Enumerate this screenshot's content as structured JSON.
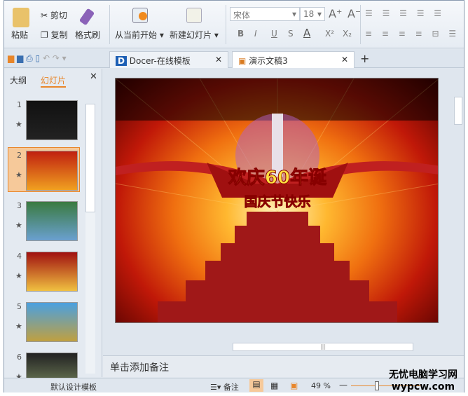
{
  "ribbon": {
    "paste": "粘贴",
    "cut": "剪切",
    "copy": "复制",
    "format_painter": "格式刷",
    "from_current": "从当前开始",
    "new_slide": "新建幻灯片",
    "font_name": "宋体",
    "font_size": "18",
    "bold": "B",
    "italic": "I",
    "underline": "U",
    "strike": "S",
    "font_color": "A",
    "superscript": "X²",
    "subscript": "X₂",
    "grow": "A⁺",
    "shrink": "A⁻"
  },
  "tabs": [
    {
      "label": "Docer-在线模板"
    },
    {
      "label": "演示文稿3"
    }
  ],
  "panel": {
    "tab_outline": "大纲",
    "tab_slides": "幻灯片",
    "slides": [
      "1",
      "2",
      "3",
      "4",
      "5",
      "6"
    ],
    "selected": 2
  },
  "slide": {
    "title": "欢庆60年诞",
    "subtitle": "国庆节快乐"
  },
  "notes": {
    "placeholder": "单击添加备注"
  },
  "status": {
    "template": "默认设计模板",
    "notes_label": "备注",
    "zoom": "49 %",
    "zoom_percent": 49
  },
  "watermark": {
    "line1": "无忧电脑学习网",
    "line2": "wypcw.com"
  }
}
